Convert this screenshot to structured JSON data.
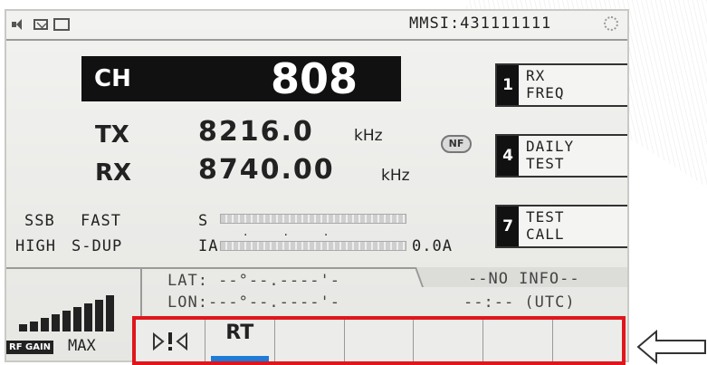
{
  "status_bar": {
    "mmsi": "MMSI:431111111",
    "icons": [
      "speaker-icon",
      "mail-icon",
      "mail-send-icon",
      "spinner-icon"
    ]
  },
  "channel": {
    "label": "CH",
    "value": "808"
  },
  "tx": {
    "label": "TX",
    "value": "8216.0",
    "unit": "kHz"
  },
  "rx": {
    "label": "RX",
    "value": "8740.00",
    "unit": "kHz"
  },
  "nf_badge": "NF",
  "softkeys": [
    {
      "num": "1",
      "line1": "RX",
      "line2": "FREQ"
    },
    {
      "num": "4",
      "line1": "DAILY",
      "line2": "TEST"
    },
    {
      "num": "7",
      "line1": "TEST",
      "line2": "CALL"
    }
  ],
  "mode": {
    "row1": [
      "SSB",
      "FAST",
      "S"
    ],
    "row2": [
      "HIGH",
      "S-DUP",
      "IA"
    ],
    "ia_reading": "0.0A"
  },
  "position": {
    "lat": "LAT: --°--.----'-",
    "lon": "LON:---°--.----'-",
    "info": "--NO INFO--",
    "time": "--:-- (UTC)"
  },
  "rf_gain": {
    "label": "RF GAIN",
    "level": "MAX"
  },
  "tabs": [
    {
      "label": "",
      "icon": "warning-icon"
    },
    {
      "label": "RT",
      "active": true
    },
    {
      "label": ""
    },
    {
      "label": ""
    },
    {
      "label": ""
    },
    {
      "label": ""
    },
    {
      "label": ""
    }
  ],
  "colors": {
    "highlight_border": "#e0161c",
    "active_tab": "#1e7bd8"
  }
}
